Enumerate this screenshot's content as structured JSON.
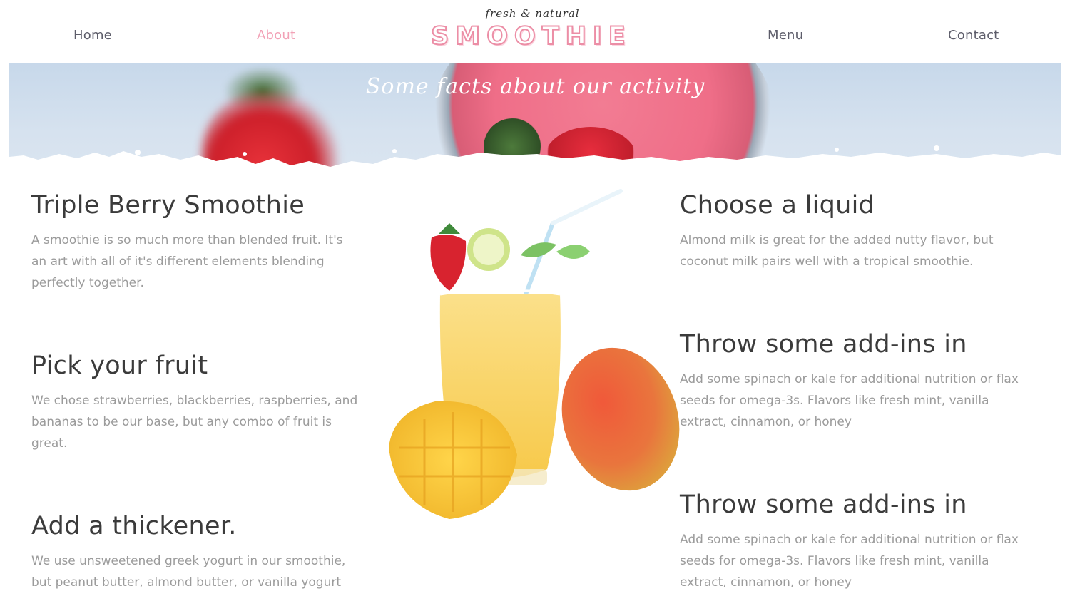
{
  "nav": {
    "home": "Home",
    "about": "About",
    "menu": "Menu",
    "contact": "Contact",
    "active": "About"
  },
  "logo": {
    "tagline": "fresh & natural",
    "brand": "SMOOTHIE"
  },
  "banner": {
    "title": "Some facts about our activity"
  },
  "left_blocks": [
    {
      "heading": "Triple Berry Smoothie",
      "text": "A smoothie is so much more than blended fruit. It's an art with all of it's different elements blending perfectly together."
    },
    {
      "heading": "Pick your fruit",
      "text": "We chose strawberries, blackberries, raspberries, and bananas to be our base, but any combo of fruit is great."
    },
    {
      "heading": "Add a thickener.",
      "text": "We use unsweetened greek yogurt in our smoothie, but peanut butter, almond butter, or vanilla yogurt"
    }
  ],
  "right_blocks": [
    {
      "heading": "Choose a liquid",
      "text": "Almond milk is great for the added nutty flavor, but coconut milk pairs well with a tropical smoothie."
    },
    {
      "heading": "Throw some add-ins in",
      "text": "Add some spinach or kale for additional nutrition or flax seeds for omega-3s. Flavors like fresh mint, vanilla extract, cinnamon, or honey"
    },
    {
      "heading": "Throw some add-ins in",
      "text": "Add some spinach or kale for additional nutrition or flax seeds for omega-3s. Flavors like fresh mint, vanilla extract, cinnamon, or honey"
    }
  ],
  "colors": {
    "accent": "#f2a1b6",
    "nav_text": "#5d5d6a",
    "heading": "#3b3b3b",
    "body_text": "#9b9b9b"
  }
}
